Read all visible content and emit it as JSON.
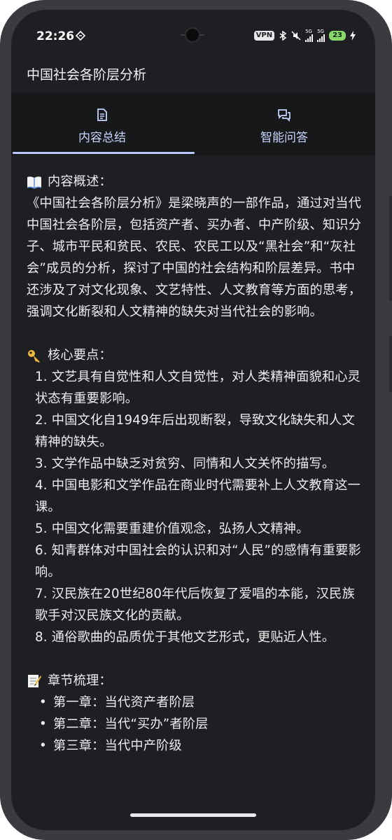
{
  "status_bar": {
    "time": "22:26",
    "vpn": "VPN",
    "signal1_label": "5G",
    "signal2_label": "5G",
    "battery": "23"
  },
  "app": {
    "title": "中国社会各阶层分析"
  },
  "tabs": [
    {
      "label": "内容总结",
      "icon": "document-icon",
      "selected": true
    },
    {
      "label": "智能问答",
      "icon": "chat-icon",
      "selected": false
    }
  ],
  "summary": {
    "overview_title": "内容概述：",
    "overview_text": "《中国社会各阶层分析》是梁晓声的一部作品，通过对当代中国社会各阶层，包括资产者、买办者、中产阶级、知识分子、城市平民和贫民、农民、农民工以及“黑社会”和“灰社会”成员的分析，探讨了中国的社会结构和阶层差异。书中还涉及了对文化现象、文艺特性、人文教育等方面的思考，强调文化断裂和人文精神的缺失对当代社会的影响。",
    "points_title": "核心要点：",
    "points": [
      "1. 文艺具有自觉性和人文自觉性，对人类精神面貌和心灵状态有重要影响。",
      "2. 中国文化自1949年后出现断裂，导致文化缺失和人文精神的缺失。",
      "3. 文学作品中缺乏对贫穷、同情和人文关怀的描写。",
      "4. 中国电影和文学作品在商业时代需要补上人文教育这一课。",
      "5. 中国文化需要重建价值观念，弘扬人文精神。",
      "6. 知青群体对中国社会的认识和对“人民”的感情有重要影响。",
      "7. 汉民族在20世纪80年代后恢复了爱唱的本能，汉民族歌手对汉民族文化的贡献。",
      "8. 通俗歌曲的品质优于其他文艺形式，更贴近人性。"
    ],
    "chapters_title": "章节梳理：",
    "chapters": [
      "第一章：当代资产者阶层",
      "第二章：当代“买办”者阶层",
      "第三章：当代中产阶级"
    ]
  },
  "icons": {
    "overview": "open-book-icon",
    "points": "key-icon",
    "chapters": "memo-icon"
  },
  "colors": {
    "background": "#1e1f22",
    "tab_bar": "#17181a",
    "accent": "#b9c6ff",
    "text": "#ecedef",
    "battery": "#8bd86a"
  }
}
